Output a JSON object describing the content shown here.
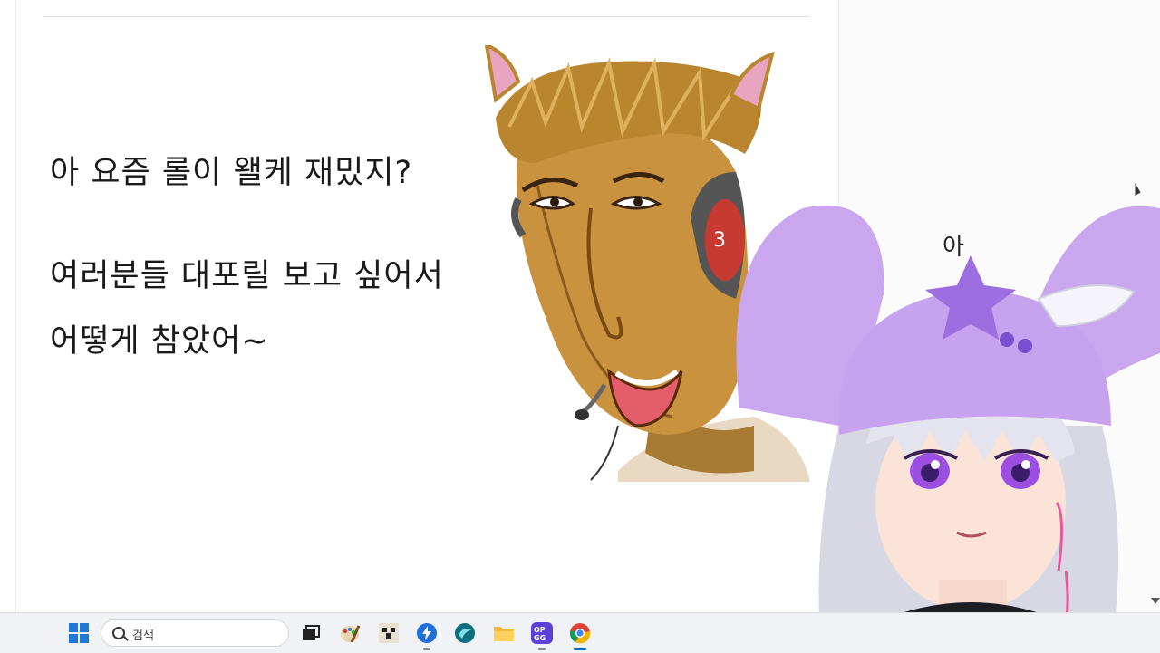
{
  "document": {
    "lines": [
      "아 요즘 롤이 왤케 재밌지?",
      "여러분들 대포릴 보고 싶어서",
      "어떻게 참았어~"
    ]
  },
  "side_panel": {
    "partial_text": "아"
  },
  "taskbar": {
    "search_placeholder": "검색",
    "apps": [
      {
        "name": "windows-start-icon"
      },
      {
        "name": "task-view-icon"
      },
      {
        "name": "paint-icon"
      },
      {
        "name": "minecraft-icon"
      },
      {
        "name": "app-blue-bolt-icon"
      },
      {
        "name": "app-swirl-icon"
      },
      {
        "name": "file-explorer-icon"
      },
      {
        "name": "opgg-icon",
        "label": "OP GG"
      },
      {
        "name": "chrome-icon"
      }
    ]
  }
}
